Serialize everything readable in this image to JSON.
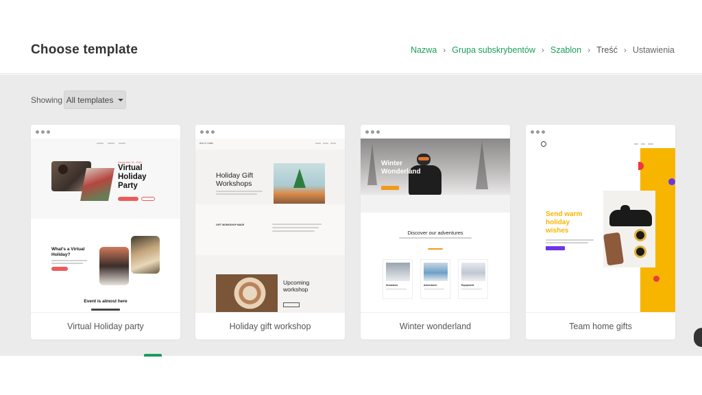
{
  "header": {
    "title": "Choose template",
    "breadcrumb": [
      {
        "label": "Nazwa",
        "state": "done"
      },
      {
        "label": "Grupa subskrybentów",
        "state": "done"
      },
      {
        "label": "Szablon",
        "state": "current"
      },
      {
        "label": "Treść",
        "state": "todo"
      },
      {
        "label": "Ustawienia",
        "state": "todo"
      }
    ]
  },
  "filter": {
    "showing_label": "Showing",
    "selected": "All templates"
  },
  "templates": [
    {
      "name": "Virtual Holiday party",
      "preview": {
        "hero_title_1": "Virtual",
        "hero_title_2": "Holiday",
        "hero_title_3": "Party",
        "date": "December 31, 2021",
        "section_title_1": "What's a Virtual",
        "section_title_2": "Holiday?",
        "footer_title": "Event is almost here"
      }
    },
    {
      "name": "Holiday gift workshop",
      "preview": {
        "brand": "Arts & Crafts",
        "hero_title_1": "Holiday Gift",
        "hero_title_2": "Workshops",
        "label_caps": "GIFT WORKSHOP MADE",
        "upcoming_1": "Upcoming",
        "upcoming_2": "workshop"
      }
    },
    {
      "name": "Winter wonderland",
      "preview": {
        "hero_title_1": "Winter",
        "hero_title_2": "Wonderland",
        "section_title": "Discover our adventures",
        "items": [
          "Snowshoe",
          "Adventures",
          "Equipment"
        ]
      }
    },
    {
      "name": "Team home gifts",
      "preview": {
        "headline_1": "Send warm",
        "headline_2": "holiday",
        "headline_3": "wishes"
      }
    }
  ],
  "colors": {
    "accent_green": "#1a9d5c",
    "coral": "#ec5a5a",
    "orange": "#f29a1a",
    "yellow": "#f7b500",
    "purple": "#6b35e8"
  }
}
